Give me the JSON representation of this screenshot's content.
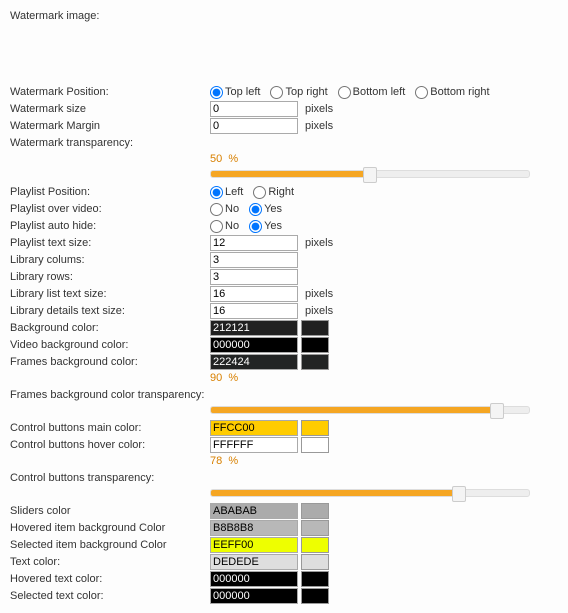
{
  "labels": {
    "watermark_image": "Watermark image:",
    "watermark_position": "Watermark Position:",
    "watermark_size": "Watermark size",
    "watermark_margin": "Watermark Margin",
    "watermark_transparency": "Watermark transparency:",
    "playlist_position": "Playlist Position:",
    "playlist_over_video": "Playlist over video:",
    "playlist_auto_hide": "Playlist auto hide:",
    "playlist_text_size": "Playlist text size:",
    "library_columns": "Library colums:",
    "library_rows": "Library rows:",
    "library_list_text_size": "Library list text size:",
    "library_details_text_size": "Library details text size:",
    "background_color": "Background color:",
    "video_background_color": "Video background color:",
    "frames_background_color": "Frames background color:",
    "frames_background_transparency": "Frames background color transparency:",
    "control_buttons_main_color": "Control buttons main color:",
    "control_buttons_hover_color": "Control buttons hover color:",
    "control_buttons_transparency": "Control buttons transparency:",
    "sliders_color": "Sliders color",
    "hovered_item_bg": "Hovered item background Color",
    "selected_item_bg": "Selected item background Color",
    "text_color": "Text color:",
    "hovered_text_color": "Hovered text color:",
    "selected_text_color": "Selected text color:"
  },
  "radios": {
    "position": [
      "Top left",
      "Top right",
      "Bottom left",
      "Bottom right"
    ],
    "leftright": [
      "Left",
      "Right"
    ],
    "noyes": [
      "No",
      "Yes"
    ]
  },
  "values": {
    "watermark_size": "0",
    "watermark_margin": "0",
    "playlist_text_size": "12",
    "library_columns": "3",
    "library_rows": "3",
    "library_list_text_size": "16",
    "library_details_text_size": "16",
    "background_color": "212121",
    "video_background_color": "000000",
    "frames_background_color": "222424",
    "control_buttons_main_color": "FFCC00",
    "control_buttons_hover_color": "FFFFFF",
    "sliders_color": "ABABAB",
    "hovered_item_bg": "B8B8B8",
    "selected_item_bg": "EEFF00",
    "text_color": "DEDEDE",
    "hovered_text_color": "000000",
    "selected_text_color": "000000"
  },
  "selections": {
    "watermark_position": "Top left",
    "playlist_position": "Left",
    "playlist_over_video": "Yes",
    "playlist_auto_hide": "Yes"
  },
  "units": {
    "pixels": "pixels",
    "percent": "%"
  },
  "percents": {
    "watermark_transparency": "50",
    "frames_background_transparency": "90",
    "control_buttons_transparency": "78"
  },
  "colors": {
    "212121": "#212121",
    "000000": "#000000",
    "222424": "#222424",
    "FFCC00": "#FFCC00",
    "FFFFFF": "#FFFFFF",
    "ABABAB": "#ABABAB",
    "B8B8B8": "#B8B8B8",
    "EEFF00": "#EEFF00",
    "DEDEDE": "#DEDEDE"
  },
  "chart_data": {
    "type": "table",
    "sliders": [
      {
        "name": "Watermark transparency",
        "value": 50,
        "min": 0,
        "max": 100
      },
      {
        "name": "Frames background color transparency",
        "value": 90,
        "min": 0,
        "max": 100
      },
      {
        "name": "Control buttons transparency",
        "value": 78,
        "min": 0,
        "max": 100
      }
    ]
  }
}
